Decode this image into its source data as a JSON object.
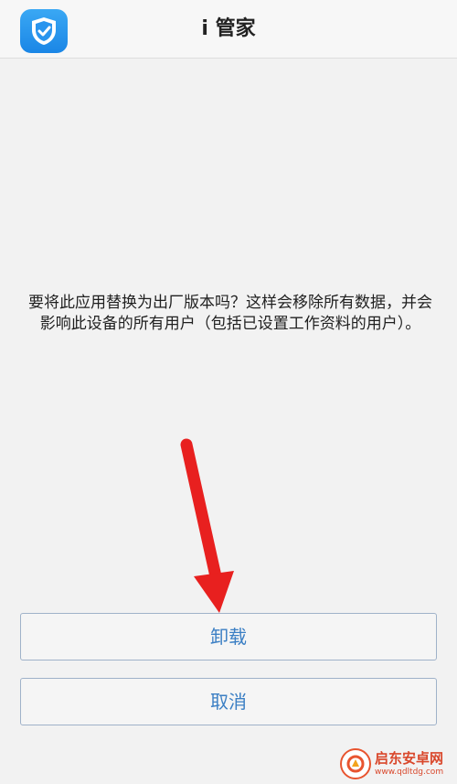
{
  "header": {
    "app_icon": "shield-check-icon",
    "title": "i 管家"
  },
  "dialog": {
    "message": "要将此应用替换为出厂版本吗？这样会移除所有数据，并会影响此设备的所有用户（包括已设置工作资料的用户）。"
  },
  "buttons": {
    "uninstall_label": "卸载",
    "cancel_label": "取消"
  },
  "annotation": {
    "arrow_icon": "red-arrow-down-icon",
    "arrow_color": "#e8201f"
  },
  "watermark": {
    "name": "启东安卓网",
    "url": "www.qdltdg.com"
  },
  "colors": {
    "accent": "#3b7fc4",
    "icon_blue": "#1a86e6",
    "background": "#f2f2f2"
  }
}
